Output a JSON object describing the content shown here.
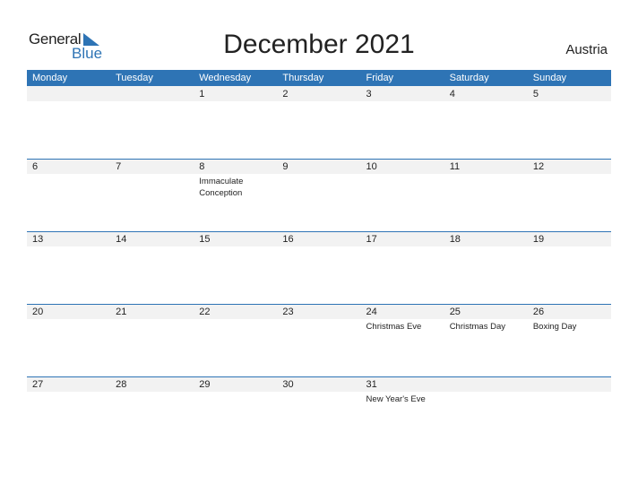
{
  "logo": {
    "general": "General",
    "blue": "Blue"
  },
  "title": "December 2021",
  "country": "Austria",
  "colors": {
    "accent": "#2e74b5",
    "band": "#f2f2f2"
  },
  "days": [
    "Monday",
    "Tuesday",
    "Wednesday",
    "Thursday",
    "Friday",
    "Saturday",
    "Sunday"
  ],
  "weeks": [
    [
      {
        "d": ""
      },
      {
        "d": ""
      },
      {
        "d": "1"
      },
      {
        "d": "2"
      },
      {
        "d": "3"
      },
      {
        "d": "4"
      },
      {
        "d": "5"
      }
    ],
    [
      {
        "d": "6"
      },
      {
        "d": "7"
      },
      {
        "d": "8",
        "h": "Immaculate Conception"
      },
      {
        "d": "9"
      },
      {
        "d": "10"
      },
      {
        "d": "11"
      },
      {
        "d": "12"
      }
    ],
    [
      {
        "d": "13"
      },
      {
        "d": "14"
      },
      {
        "d": "15"
      },
      {
        "d": "16"
      },
      {
        "d": "17"
      },
      {
        "d": "18"
      },
      {
        "d": "19"
      }
    ],
    [
      {
        "d": "20"
      },
      {
        "d": "21"
      },
      {
        "d": "22"
      },
      {
        "d": "23"
      },
      {
        "d": "24",
        "h": "Christmas Eve"
      },
      {
        "d": "25",
        "h": "Christmas Day"
      },
      {
        "d": "26",
        "h": "Boxing Day"
      }
    ],
    [
      {
        "d": "27"
      },
      {
        "d": "28"
      },
      {
        "d": "29"
      },
      {
        "d": "30"
      },
      {
        "d": "31",
        "h": "New Year's Eve"
      },
      {
        "d": ""
      },
      {
        "d": ""
      }
    ]
  ]
}
